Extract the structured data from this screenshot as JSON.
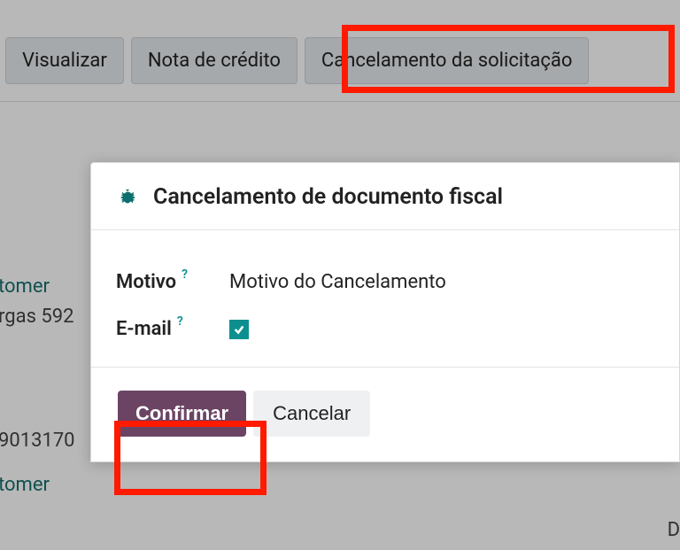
{
  "toolbar": {
    "buttons": [
      {
        "label": "Visualizar"
      },
      {
        "label": "Nota de crédito"
      },
      {
        "label": "Cancelamento da solicitação"
      }
    ]
  },
  "background": {
    "text1": "tomer",
    "text2": "rgas 592",
    "text3": "9013170",
    "text4": "tomer",
    "text5": "D"
  },
  "modal": {
    "title": "Cancelamento de documento fiscal",
    "motivo_label": "Motivo",
    "motivo_value": "Motivo do Cancelamento",
    "email_label": "E-mail",
    "email_checked": true,
    "confirm_label": "Confirmar",
    "cancel_label": "Cancelar"
  }
}
